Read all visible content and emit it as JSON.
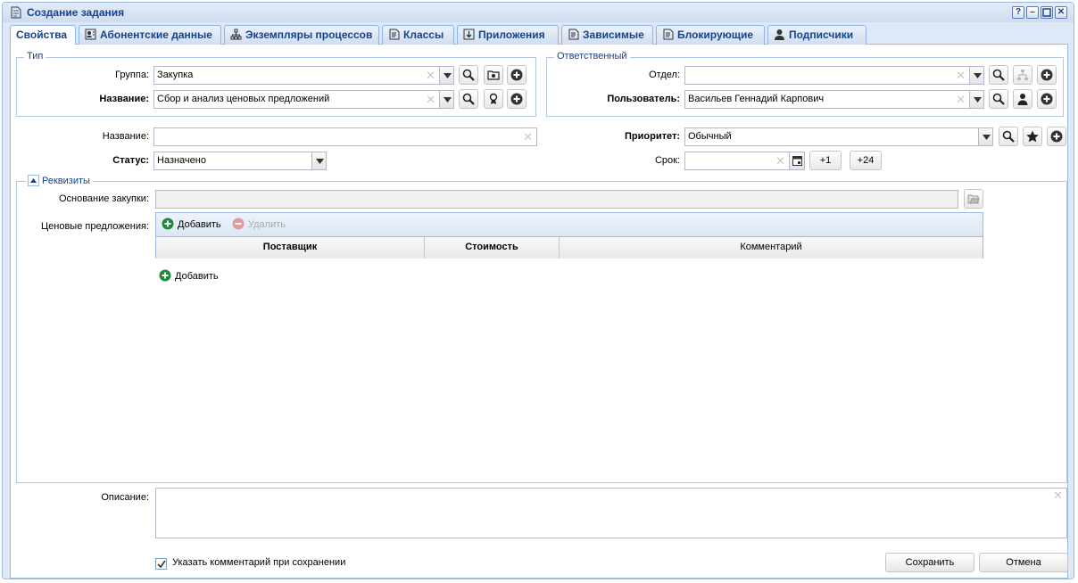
{
  "window": {
    "title": "Создание задания"
  },
  "tabs": [
    {
      "label": "Свойства",
      "icon": "none",
      "active": true
    },
    {
      "label": "Абонентские данные",
      "icon": "contact-card-icon"
    },
    {
      "label": "Экземпляры процессов",
      "icon": "hierarchy-icon"
    },
    {
      "label": "Классы",
      "icon": "document-icon"
    },
    {
      "label": "Приложения",
      "icon": "download-icon"
    },
    {
      "label": "Зависимые",
      "icon": "document-icon"
    },
    {
      "label": "Блокирующие",
      "icon": "document-icon"
    },
    {
      "label": "Подписчики",
      "icon": "user-icon"
    }
  ],
  "type_group": {
    "legend": "Тип",
    "group_label": "Группа:",
    "group_value": "Закупка",
    "name_label": "Название:",
    "name_value": "Сбор и анализ ценовых предложений"
  },
  "responsible": {
    "legend": "Ответственный",
    "department_label": "Отдел:",
    "department_value": "",
    "user_label": "Пользователь:",
    "user_value": "Васильев Геннадий Карпович"
  },
  "task": {
    "name_label": "Название:",
    "name_value": "",
    "status_label": "Статус:",
    "status_value": "Назначено",
    "priority_label": "Приоритет:",
    "priority_value": "Обычный",
    "deadline_label": "Срок:",
    "deadline_value": "",
    "plus1_label": "+1",
    "plus24_label": "+24"
  },
  "requisites": {
    "legend": "Реквизиты",
    "basis_label": "Основание закупки:",
    "basis_value": "",
    "offers_label": "Ценовые предложения:",
    "add_label": "Добавить",
    "delete_label": "Удалить",
    "columns": [
      "Поставщик",
      "Стоимость",
      "Комментарий"
    ],
    "add_bottom_label": "Добавить"
  },
  "description": {
    "label": "Описание:",
    "value": ""
  },
  "footer": {
    "comment_checkbox_label": "Указать комментарий при сохранении",
    "comment_checked": true,
    "save_label": "Сохранить",
    "cancel_label": "Отмена"
  },
  "colors": {
    "accent": "#15428b",
    "border": "#99bbe8",
    "panel_bg": "#dfe8f6",
    "add_green": "#1e8a3c",
    "delete_red": "#e39a9a"
  }
}
